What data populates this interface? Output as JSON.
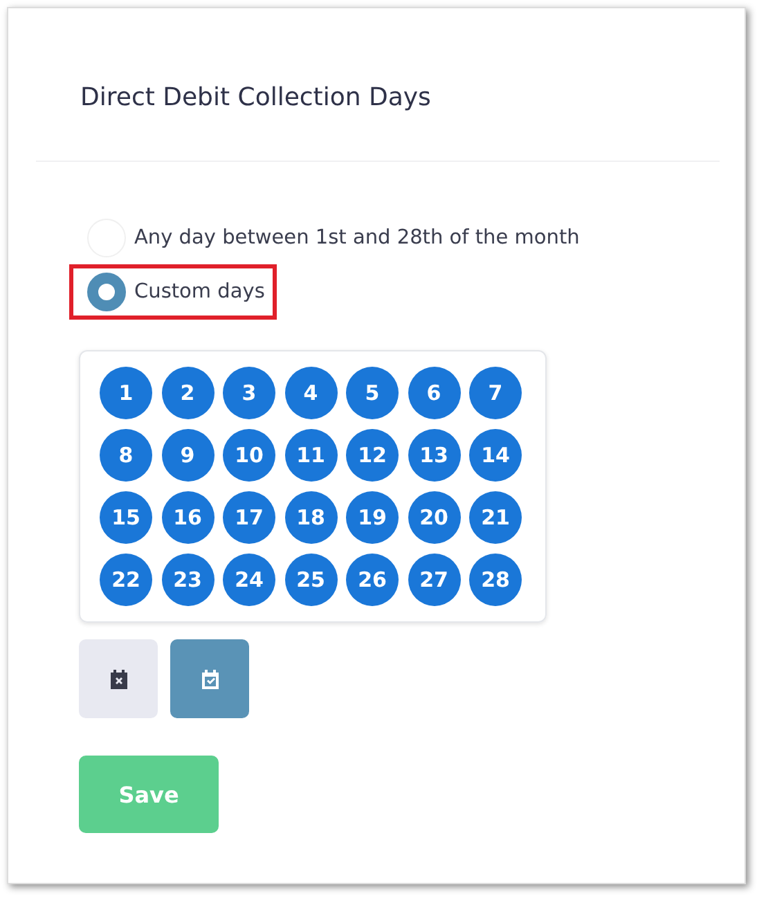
{
  "title": "Direct Debit Collection Days",
  "options": [
    {
      "label": "Any day between 1st and 28th of the month",
      "selected": false,
      "highlighted": false
    },
    {
      "label": "Custom days",
      "selected": true,
      "highlighted": true
    }
  ],
  "days": [
    {
      "label": "1",
      "selected": true
    },
    {
      "label": "2",
      "selected": true
    },
    {
      "label": "3",
      "selected": true
    },
    {
      "label": "4",
      "selected": true
    },
    {
      "label": "5",
      "selected": true
    },
    {
      "label": "6",
      "selected": true
    },
    {
      "label": "7",
      "selected": true
    },
    {
      "label": "8",
      "selected": true
    },
    {
      "label": "9",
      "selected": true
    },
    {
      "label": "10",
      "selected": true
    },
    {
      "label": "11",
      "selected": true
    },
    {
      "label": "12",
      "selected": true
    },
    {
      "label": "13",
      "selected": true
    },
    {
      "label": "14",
      "selected": true
    },
    {
      "label": "15",
      "selected": true
    },
    {
      "label": "16",
      "selected": true
    },
    {
      "label": "17",
      "selected": true
    },
    {
      "label": "18",
      "selected": true
    },
    {
      "label": "19",
      "selected": true
    },
    {
      "label": "20",
      "selected": true
    },
    {
      "label": "21",
      "selected": true
    },
    {
      "label": "22",
      "selected": true
    },
    {
      "label": "23",
      "selected": true
    },
    {
      "label": "24",
      "selected": true
    },
    {
      "label": "25",
      "selected": true
    },
    {
      "label": "26",
      "selected": true
    },
    {
      "label": "27",
      "selected": true
    },
    {
      "label": "28",
      "selected": true
    }
  ],
  "tools": [
    {
      "kind": "clear"
    },
    {
      "kind": "select-all"
    }
  ],
  "save_button": "Save"
}
